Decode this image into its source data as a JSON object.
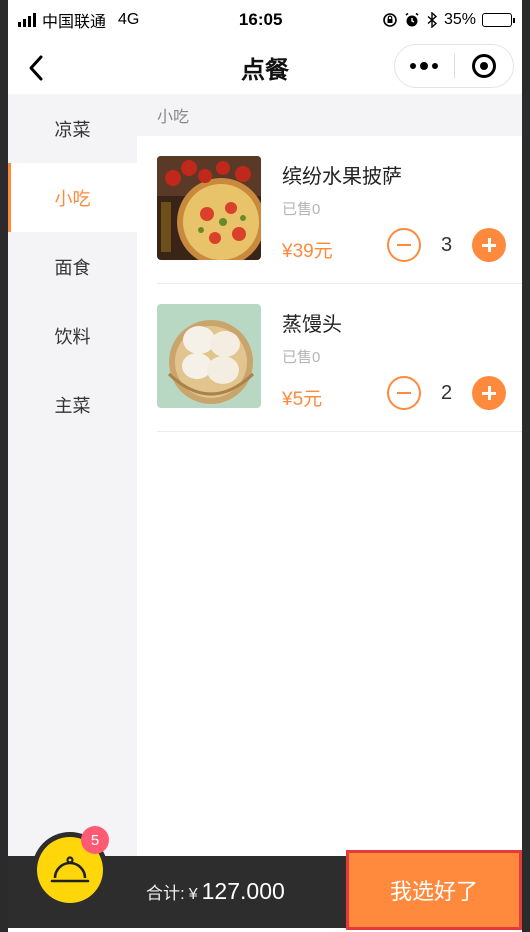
{
  "status_bar": {
    "carrier": "中国联通",
    "network": "4G",
    "time": "16:05",
    "battery": "35%"
  },
  "nav": {
    "title": "点餐"
  },
  "categories": [
    {
      "label": "凉菜"
    },
    {
      "label": "小吃"
    },
    {
      "label": "面食"
    },
    {
      "label": "饮料"
    },
    {
      "label": "主菜"
    }
  ],
  "active_category": "小吃",
  "section": {
    "header": "小吃"
  },
  "products": [
    {
      "name": "缤纷水果披萨",
      "sold": "已售0",
      "price": "¥39元",
      "quantity": "3",
      "image": "pizza"
    },
    {
      "name": "蒸馒头",
      "sold": "已售0",
      "price": "¥5元",
      "quantity": "2",
      "image": "steamed-buns"
    }
  ],
  "cart": {
    "badge_count": "5",
    "total_label": "合计:",
    "currency": "¥",
    "total_amount": "127.000",
    "confirm_label": "我选好了"
  },
  "colors": {
    "accent": "#ff8a3d",
    "bottom_bar": "#2d2d2d",
    "cart_button": "#ffd60a",
    "badge": "#ff5a73",
    "highlight_border": "#e53a3a"
  }
}
